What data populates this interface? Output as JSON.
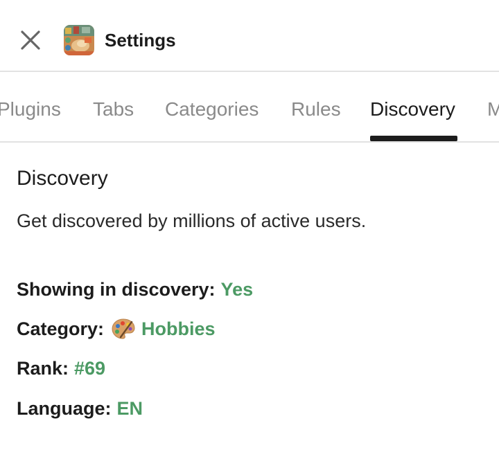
{
  "header": {
    "title": "Settings",
    "close_icon": "close-icon",
    "app_icon": "app-thumbnail"
  },
  "tabs": [
    {
      "label": "Plugins",
      "active": false
    },
    {
      "label": "Tabs",
      "active": false
    },
    {
      "label": "Categories",
      "active": false
    },
    {
      "label": "Rules",
      "active": false
    },
    {
      "label": "Discovery",
      "active": true
    },
    {
      "label": "M",
      "active": false
    }
  ],
  "discovery": {
    "title": "Discovery",
    "description": "Get discovered by millions of active users.",
    "showing_label": "Showing in discovery:",
    "showing_value": "Yes",
    "category_label": "Category:",
    "category_icon": "palette-icon",
    "category_value": "Hobbies",
    "rank_label": "Rank:",
    "rank_value": "#69",
    "language_label": "Language:",
    "language_value": "EN"
  },
  "colors": {
    "accent_green": "#4c9a64",
    "text_dark": "#1c1c1c",
    "tab_inactive": "#8a8a8a",
    "divider": "#e2e2e2"
  }
}
